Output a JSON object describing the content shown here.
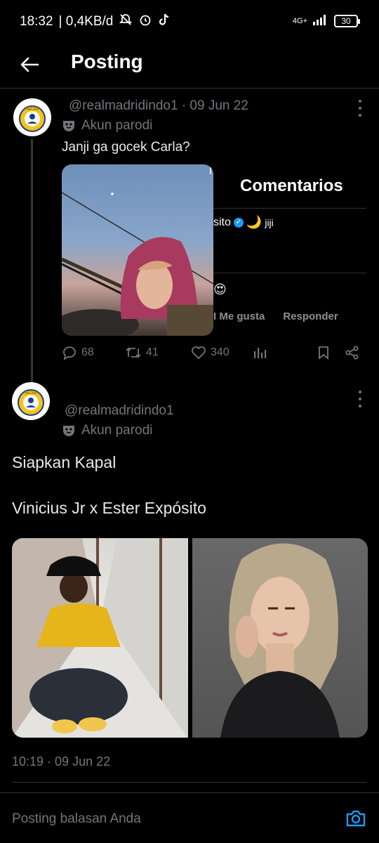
{
  "status_bar": {
    "time": "18:32",
    "net_speed": "| 0,4KB/d",
    "network_label": "4G+",
    "battery": "30"
  },
  "header": {
    "title": "Posting"
  },
  "parent_tweet": {
    "handle_date": "@realmadridindo1 · 09 Jun 22",
    "parody_label": "Akun parodi",
    "text": "Janji ga gocek Carla?",
    "embed": {
      "panel_title": "Comentarios",
      "user_fragment": "sito",
      "comment_fragment": "jiji",
      "reaction_emoji": "😍",
      "like_label": "I Me gusta",
      "reply_label": "Responder"
    },
    "stats": {
      "replies": "68",
      "retweets": "41",
      "likes": "340"
    }
  },
  "main_tweet": {
    "handle": "@realmadridindo1",
    "parody_label": "Akun parodi",
    "text_line1": "Siapkan Kapal",
    "text_line2": "Vinicius Jr x Ester Expósito",
    "timestamp": "10:19 · 09 Jun 22"
  },
  "reply_bar": {
    "placeholder": "Posting balasan Anda"
  },
  "colors": {
    "background": "#000000",
    "text_primary": "#e7e9ea",
    "text_secondary": "#71767b",
    "accent": "#1d9bf0",
    "divider": "#2f3336"
  }
}
